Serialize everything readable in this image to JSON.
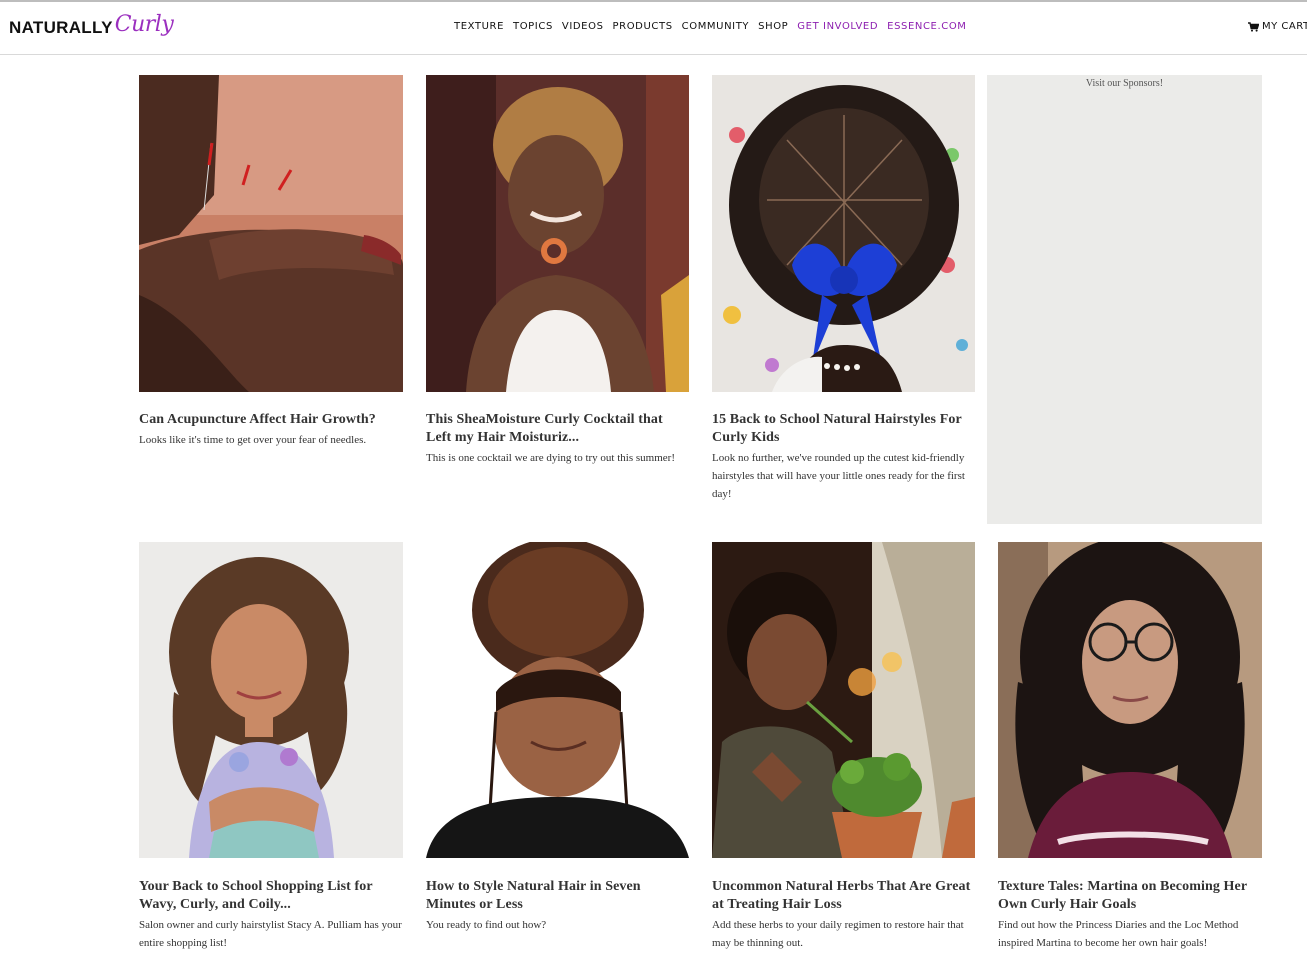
{
  "header": {
    "logo_primary": "NATURALLY",
    "logo_secondary": "Curly",
    "nav": [
      {
        "label": "TEXTURE"
      },
      {
        "label": "TOPICS"
      },
      {
        "label": "VIDEOS"
      },
      {
        "label": "PRODUCTS"
      },
      {
        "label": "COMMUNITY"
      },
      {
        "label": "SHOP"
      },
      {
        "label": "GET INVOLVED",
        "accent": true
      },
      {
        "label": "ESSENCE.COM",
        "accent": true
      }
    ],
    "cart_label": "MY CART",
    "cart_icon": "cart-icon"
  },
  "sponsor": {
    "label": "Visit our Sponsors!"
  },
  "articles": [
    {
      "title": "Can Acupuncture Affect Hair Growth?",
      "description": "Looks like it's time to get over your fear of needles."
    },
    {
      "title": "This SheaMoisture Curly Cocktail that Left my Hair Moisturiz...",
      "description": "This is one cocktail we are dying to try out this summer!"
    },
    {
      "title": "15 Back to School Natural Hairstyles For Curly Kids",
      "description": "Look no further, we've rounded up the cutest kid-friendly hairstyles that will have your little ones ready for the first day!"
    },
    {
      "title": "Your Back to School Shopping List for Wavy, Curly, and Coily...",
      "description": "Salon owner and curly hairstylist Stacy A. Pulliam has your entire shopping list!"
    },
    {
      "title": "How to Style Natural Hair in Seven Minutes or Less",
      "description": "You ready to find out how?"
    },
    {
      "title": "Uncommon Natural Herbs That Are Great at Treating Hair Loss",
      "description": "Add these herbs to your daily regimen to restore hair that may be thinning out."
    },
    {
      "title": "Texture Tales: Martina on Becoming Her Own Curly Hair Goals",
      "description": "Find out how the Princess Diaries and the Loc Method inspired Martina to become her own hair goals!"
    }
  ],
  "colors": {
    "accent": "#8d1fb0",
    "text": "#333333",
    "sponsor_bg": "#ebebe9"
  }
}
